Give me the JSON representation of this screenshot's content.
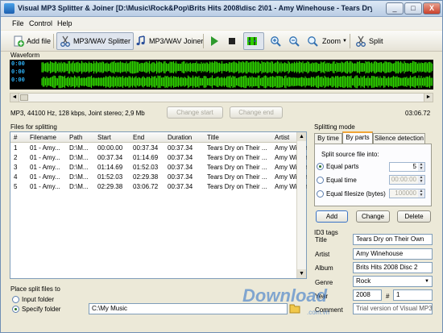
{
  "window": {
    "title": "Visual MP3 Splitter & Joiner [D:\\Music\\Rock&Pop\\Brits Hits 2008\\disc 2\\01 - Amy Winehouse - Tears Dry On Their Own",
    "min_glyph": "_",
    "max_glyph": "□",
    "close_glyph": "X"
  },
  "menu": {
    "file": "File",
    "control": "Control",
    "help": "Help"
  },
  "toolbar": {
    "add_file": "Add file",
    "splitter": "MP3/WAV Splitter",
    "joiner": "MP3/WAV Joiner",
    "zoom": "Zoom",
    "split": "Split"
  },
  "waveform": {
    "label": "Waveform",
    "times": [
      "0:00",
      "0:00",
      "0:00"
    ],
    "file_info": "MP3, 44100 Hz, 128 kbps, Joint stereo; 2,9 Mb",
    "change_start": "Change start",
    "change_end": "Change end",
    "duration": "03:06.72",
    "left_arrow": "◄",
    "right_arrow": "►"
  },
  "files_table": {
    "label": "Files for splitting",
    "columns": [
      "#",
      "Filename",
      "Path",
      "Start",
      "End",
      "Duration",
      "Title",
      "Artist"
    ],
    "rows": [
      [
        "1",
        "01 - Amy...",
        "D:\\M...",
        "00:00.00",
        "00:37.34",
        "00:37.34",
        "Tears Dry on Their ...",
        "Amy Winehouse"
      ],
      [
        "2",
        "01 - Amy...",
        "D:\\M...",
        "00:37.34",
        "01:14.69",
        "00:37.34",
        "Tears Dry on Their ...",
        "Amy Winehouse"
      ],
      [
        "3",
        "01 - Amy...",
        "D:\\M...",
        "01:14.69",
        "01:52.03",
        "00:37.34",
        "Tears Dry on Their ...",
        "Amy Winehouse"
      ],
      [
        "4",
        "01 - Amy...",
        "D:\\M...",
        "01:52.03",
        "02:29.38",
        "00:37.34",
        "Tears Dry on Their ...",
        "Amy Winehouse"
      ],
      [
        "5",
        "01 - Amy...",
        "D:\\M...",
        "02:29.38",
        "03:06.72",
        "00:37.34",
        "Tears Dry on Their ...",
        "Amy Winehouse"
      ]
    ]
  },
  "splitting_mode": {
    "label": "Splitting mode",
    "tabs": [
      "By time",
      "By parts",
      "Silence detection"
    ],
    "split_into_label": "Split source file into:",
    "equal_parts_label": "Equal parts",
    "equal_parts_value": "5",
    "equal_time_label": "Equal time",
    "equal_time_value": "00:00:00",
    "equal_filesize_label": "Equal filesize (bytes)",
    "equal_filesize_value": "100000",
    "add": "Add",
    "change": "Change",
    "delete": "Delete"
  },
  "id3": {
    "label": "ID3 tags",
    "title_label": "Title",
    "title_value": "Tears Dry on Their Own",
    "artist_label": "Artist",
    "artist_value": "Amy Winehouse",
    "album_label": "Album",
    "album_value": "Brits Hits 2008 Disc 2",
    "genre_label": "Genre",
    "genre_value": "Rock",
    "year_label": "Year",
    "year_value": "2008",
    "track_label": "#",
    "track_value": "1",
    "comment_label": "Comment",
    "comment_value": "Trial version of Visual MP3 Sp"
  },
  "output": {
    "label": "Place split files to",
    "input_folder": "Input folder",
    "specify_folder": "Specify folder",
    "folder_path": "C:\\My Music"
  },
  "watermark": {
    "brand": "Download",
    "domain": ".com.vn"
  },
  "colors": {
    "wave": "#2dcf00",
    "wave_bg": "#000000",
    "tab_accent": "#f1a535",
    "time_text": "#2fb7ff"
  }
}
